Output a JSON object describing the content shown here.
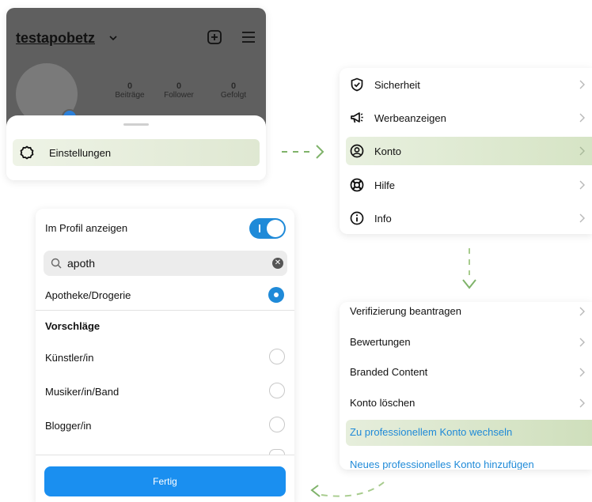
{
  "colors": {
    "accent_blue": "#1f8ad8",
    "highlight_green": "#dfe8d2",
    "arrow_green": "#7fb36a"
  },
  "profile": {
    "username": "testapobetz",
    "stats": [
      {
        "value": "0",
        "label": "Beiträge"
      },
      {
        "value": "0",
        "label": "Follower"
      },
      {
        "value": "0",
        "label": "Gefolgt"
      }
    ],
    "sheet_item": "Einstellungen"
  },
  "settings_menu": {
    "items": [
      {
        "label": "Sicherheit",
        "icon": "shield-icon"
      },
      {
        "label": "Werbeanzeigen",
        "icon": "megaphone-icon"
      },
      {
        "label": "Konto",
        "icon": "account-icon"
      },
      {
        "label": "Hilfe",
        "icon": "lifebuoy-icon"
      },
      {
        "label": "Info",
        "icon": "info-icon"
      }
    ]
  },
  "account_menu": {
    "items": [
      {
        "label": "Verifizierung beantragen"
      },
      {
        "label": "Bewertungen"
      },
      {
        "label": "Branded Content"
      },
      {
        "label": "Konto löschen"
      },
      {
        "label": "Zu professionellem Konto wechseln"
      },
      {
        "label": "Neues professionelles Konto hinzufügen"
      }
    ]
  },
  "category": {
    "toggle_label": "Im Profil anzeigen",
    "toggle_on": true,
    "search_value": "apoth",
    "selected": "Apotheke/Drogerie",
    "suggestions_heading": "Vorschläge",
    "suggestions": [
      "Künstler/in",
      "Musiker/in/Band",
      "Blogger/in"
    ],
    "done_button": "Fertig"
  }
}
